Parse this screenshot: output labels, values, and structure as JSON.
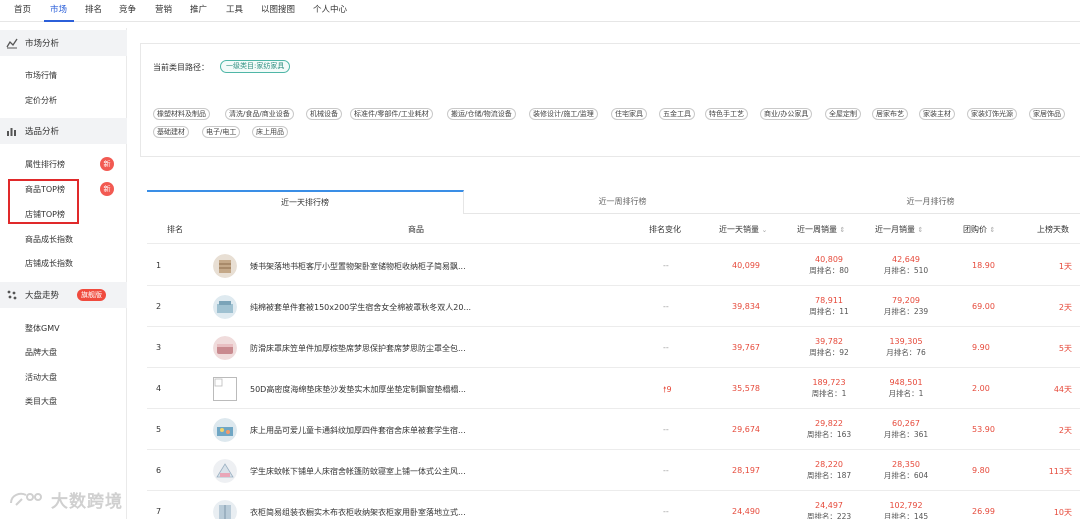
{
  "topnav": {
    "items": [
      {
        "label": "首页"
      },
      {
        "label": "市场"
      },
      {
        "label": "排名"
      },
      {
        "label": "竞争"
      },
      {
        "label": "营销"
      },
      {
        "label": "推广"
      },
      {
        "label": "工具"
      },
      {
        "label": "以图搜图"
      },
      {
        "label": "个人中心"
      }
    ],
    "active_label": "市场"
  },
  "sidebar": {
    "sections": [
      {
        "label": "市场分析",
        "icon": "trend-line-icon",
        "items": [
          {
            "label": "市场行情"
          },
          {
            "label": "定价分析"
          }
        ]
      },
      {
        "label": "选品分析",
        "icon": "bar-chart-icon",
        "items": [
          {
            "label": "属性排行榜",
            "badge": "新"
          },
          {
            "label": "商品TOP榜",
            "badge": "新"
          },
          {
            "label": "店铺TOP榜"
          },
          {
            "label": "商品成长指数"
          },
          {
            "label": "店铺成长指数"
          }
        ]
      },
      {
        "label": "大盘走势",
        "icon": "scatter-icon",
        "badge": "旗舰版",
        "items": [
          {
            "label": "整体GMV"
          },
          {
            "label": "品牌大盘"
          },
          {
            "label": "活动大盘"
          },
          {
            "label": "类目大盘"
          }
        ]
      }
    ]
  },
  "watermark": {
    "text": "大数跨境"
  },
  "category_panel": {
    "path_label": "当前类目路径：",
    "path_value": "一级类目:家纺家具",
    "categories": [
      "橡塑材料及制品",
      "清洗/食品/商业设备",
      "机械设备",
      "标准件/零部件/工业耗材",
      "搬运/仓储/物流设备",
      "装修设计/施工/监理",
      "住宅家具",
      "五金工具",
      "特色手工艺",
      "商业/办公家具",
      "全屋定制",
      "居家布艺",
      "家装主材",
      "家装灯饰光源",
      "家居饰品",
      "基础建材",
      "电子/电工",
      "床上用品"
    ]
  },
  "tabs": [
    "近一天排行榜",
    "近一周排行榜",
    "近一月排行榜"
  ],
  "table": {
    "headers": {
      "rank": "排名",
      "product": "商品",
      "change": "排名变化",
      "day_sales": "近一天销量",
      "week_sales": "近一周销量",
      "month_sales": "近一月销量",
      "price": "团购价",
      "days_on_list": "上榜天数"
    },
    "week_rank_prefix": "周排名：",
    "month_rank_prefix": "月排名：",
    "rows": [
      {
        "rank": "1",
        "name": "矮书架落地书柜客厅小型置物架卧室储物柜收纳柜子简易飘...",
        "change": "--",
        "day": "40,099",
        "week": "40,809",
        "week_rank": "80",
        "month": "42,649",
        "month_rank": "510",
        "price": "18.90",
        "days": "1天",
        "thumb": "thumb-rack"
      },
      {
        "rank": "2",
        "name": "纯棉被套单件套被150x200学生宿舍女全棉被罩秋冬双人20...",
        "change": "--",
        "day": "39,834",
        "week": "78,911",
        "week_rank": "11",
        "month": "79,209",
        "month_rank": "239",
        "price": "69.00",
        "days": "2天",
        "thumb": "thumb-quilt"
      },
      {
        "rank": "3",
        "name": "防滑床罩床笠单件加厚棕垫席梦思保护套席梦思防尘罩全包...",
        "change": "--",
        "day": "39,767",
        "week": "39,782",
        "week_rank": "92",
        "month": "139,305",
        "month_rank": "76",
        "price": "9.90",
        "days": "5天",
        "thumb": "thumb-bedcover"
      },
      {
        "rank": "4",
        "name": "50D高密度海绵垫床垫沙发垫实木加厚坐垫定制飘窗垫榻榻...",
        "change": "9",
        "change_dir": "up",
        "day": "35,578",
        "week": "189,723",
        "week_rank": "1",
        "month": "948,501",
        "month_rank": "1",
        "price": "2.00",
        "days": "44天",
        "thumb": "thumb-empty"
      },
      {
        "rank": "5",
        "name": "床上用品可爱儿童卡通斜纹加厚四件套宿舍床单被套学生宿...",
        "change": "--",
        "day": "29,674",
        "week": "29,822",
        "week_rank": "163",
        "month": "60,267",
        "month_rank": "361",
        "price": "53.90",
        "days": "2天",
        "thumb": "thumb-kids"
      },
      {
        "rank": "6",
        "name": "学生床蚊帐下铺单人床宿舍帐篷防蚊寝室上铺一体式公主风...",
        "change": "--",
        "day": "28,197",
        "week": "28,220",
        "week_rank": "187",
        "month": "28,350",
        "month_rank": "604",
        "price": "9.80",
        "days": "113天",
        "thumb": "thumb-net"
      },
      {
        "rank": "7",
        "name": "衣柜简易组装衣橱实木布衣柜收纳架衣柜家用卧室落地立式...",
        "change": "--",
        "day": "24,490",
        "week": "24,497",
        "week_rank": "223",
        "month": "102,792",
        "month_rank": "145",
        "price": "26.99",
        "days": "10天",
        "thumb": "thumb-wardrobe"
      }
    ]
  }
}
